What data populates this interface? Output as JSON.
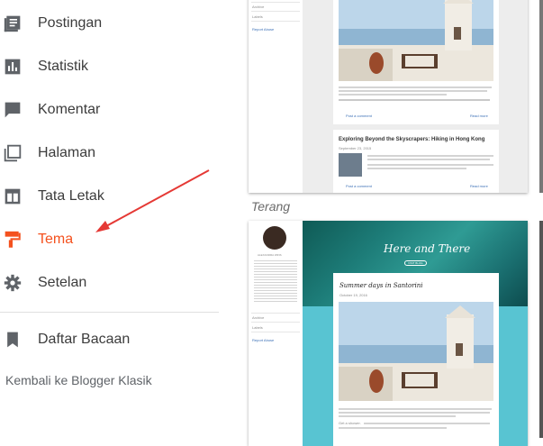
{
  "sidebar": {
    "items": [
      {
        "label": "Postingan",
        "icon": "posts-icon"
      },
      {
        "label": "Statistik",
        "icon": "stats-icon"
      },
      {
        "label": "Komentar",
        "icon": "comment-icon"
      },
      {
        "label": "Halaman",
        "icon": "pages-icon"
      },
      {
        "label": "Tata Letak",
        "icon": "layout-icon"
      },
      {
        "label": "Tema",
        "icon": "theme-paint-roller-icon",
        "active": true
      },
      {
        "label": "Setelan",
        "icon": "settings-gear-icon"
      },
      {
        "label": "Daftar Bacaan",
        "icon": "bookmark-icon"
      }
    ],
    "classic_link": "Kembali ke Blogger Klasik"
  },
  "annotation": {
    "type": "red-arrow",
    "color": "#e53935",
    "points_to": "Tema"
  },
  "colors": {
    "accent": "#f4511e",
    "arrow": "#e53935",
    "teal": "#58c4d2"
  },
  "themes": {
    "top": {
      "side_links": [
        "Archive",
        "Labels",
        "Report Abuse"
      ],
      "footer_left": "Post a comment",
      "footer_right": "Read more",
      "post2_title": "Exploring Beyond the Skyscrapers: Hiking in Hong Kong",
      "post2_date": "September 23, 2015",
      "post2_footer_left": "Post a comment",
      "post2_footer_right": "Read more"
    },
    "bottom_label": "Terang",
    "bottom": {
      "blog_title": "Here and There",
      "header_button": "VISIT BLOG",
      "author": "ALEXANDRA WINS",
      "post_title": "Summer days in Santorini",
      "post_date": "October 19, 2016",
      "side_links": [
        "Archive",
        "Labels",
        "Report Abuse"
      ],
      "snippet_label": "Get a shower."
    }
  }
}
